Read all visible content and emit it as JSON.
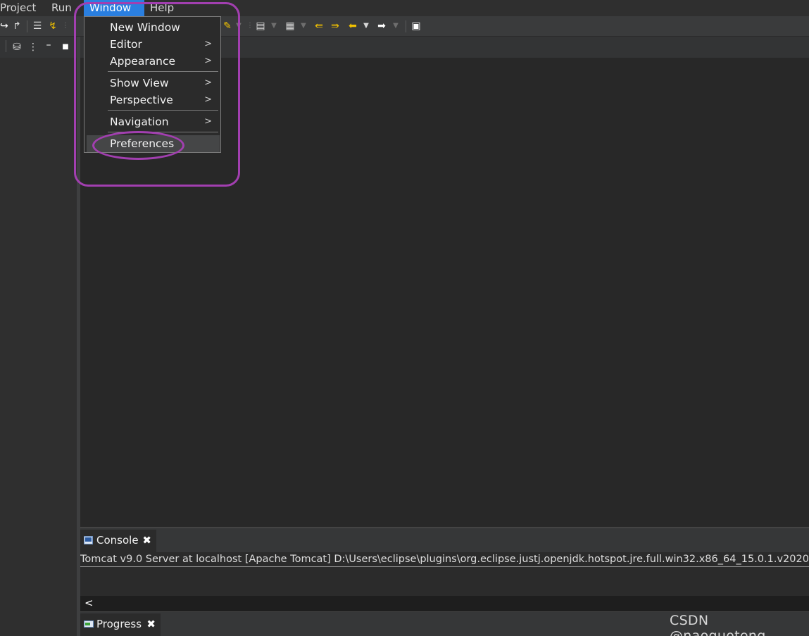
{
  "menubar": {
    "items": [
      {
        "label": "Project"
      },
      {
        "label": "Run"
      },
      {
        "label": "Window"
      },
      {
        "label": "Help"
      }
    ],
    "active": "Window",
    "active_color": "#2a7fe0"
  },
  "window_menu": {
    "items": [
      {
        "label": "New Window",
        "submenu": false
      },
      {
        "label": "Editor",
        "submenu": true
      },
      {
        "label": "Appearance",
        "submenu": true
      },
      {
        "label": "Show View",
        "submenu": true
      },
      {
        "label": "Perspective",
        "submenu": true
      },
      {
        "label": "Navigation",
        "submenu": true
      },
      {
        "label": "Preferences",
        "submenu": false,
        "highlighted": true
      }
    ],
    "chevron": ">"
  },
  "console": {
    "tab_label": "Console",
    "close_glyph": "✖",
    "line": "Tomcat v9.0 Server at localhost [Apache Tomcat] D:\\Users\\eclipse\\plugins\\org.eclipse.justj.openjdk.hotspot.jre.full.win32.x86_64_15.0.1.v2020",
    "scroll_left": "<"
  },
  "progress": {
    "tab_label": "Progress",
    "close_glyph": "✖"
  },
  "watermark": "CSDN @naoguoteng",
  "annotation_color": "#a23fb0",
  "icons": [
    "redo-icon",
    "step-return-icon",
    "list-icon",
    "step-into-icon",
    "brush-icon",
    "bookmark-icon",
    "annotation-icon",
    "prev-edit-icon",
    "next-edit-icon",
    "back-icon",
    "forward-icon",
    "open-task-icon",
    "collapse-icon",
    "minimize-icon",
    "maximize-icon"
  ]
}
